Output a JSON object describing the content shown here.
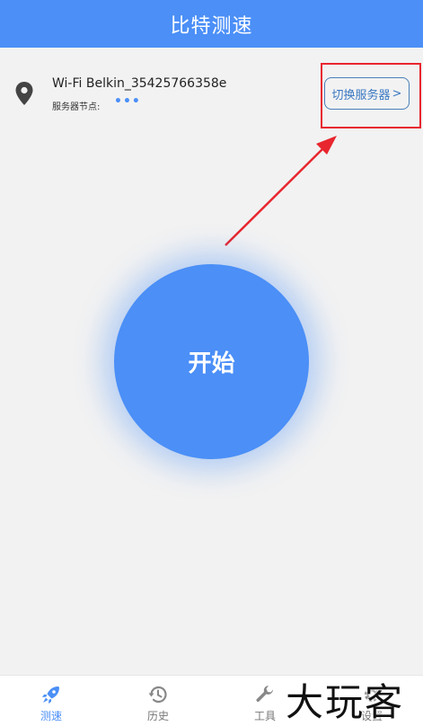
{
  "header": {
    "title": "比特测速"
  },
  "network": {
    "wifi_name": "Wi-Fi Belkin_35425766358e",
    "server_label": "服务器节点:",
    "server_value": "•••",
    "switch_button_label": "切换服务器",
    "switch_chevron": ">"
  },
  "main": {
    "start_label": "开始"
  },
  "tabs": [
    {
      "label": "测速",
      "icon": "rocket-icon",
      "active": true
    },
    {
      "label": "历史",
      "icon": "history-icon",
      "active": false
    },
    {
      "label": "工具",
      "icon": "wrench-icon",
      "active": false
    },
    {
      "label": "设置",
      "icon": "gear-icon",
      "active": false
    }
  ],
  "watermark": {
    "text": "大玩客"
  },
  "colors": {
    "brand": "#4b8ff7",
    "annotation": "#e8262e",
    "background": "#f2f2f2"
  }
}
